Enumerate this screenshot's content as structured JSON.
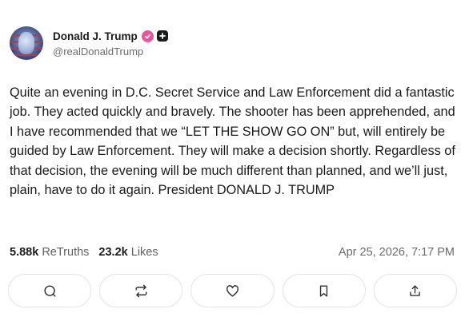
{
  "author": {
    "display_name": "Donald J. Trump",
    "handle": "@realDonaldTrump"
  },
  "post": {
    "text": "Quite an evening in D.C. Secret Service and Law Enforcement did a fantastic job. They acted quickly and bravely. The shooter has been apprehended, and I have recommended that we “LET THE SHOW GO ON” but, will entirely be guided by Law Enforcement. They will make a decision shortly. Regardless of that decision, the evening will be much different than planned, and we’ll just, plain, have to do it again. President DONALD J. TRUMP",
    "timestamp": "Apr 25, 2026, 7:17 PM"
  },
  "stats": {
    "retruths_count": "5.88k",
    "retruths_label": "ReTruths",
    "likes_count": "23.2k",
    "likes_label": "Likes"
  },
  "actions": {
    "icons": [
      "reply-icon",
      "retruth-icon",
      "like-icon",
      "bookmark-icon",
      "share-icon"
    ]
  },
  "colors": {
    "verified_badge": "#e6579a",
    "text": "#1a1a1a",
    "muted": "#6b6b6b",
    "border": "#e3e3e3"
  }
}
